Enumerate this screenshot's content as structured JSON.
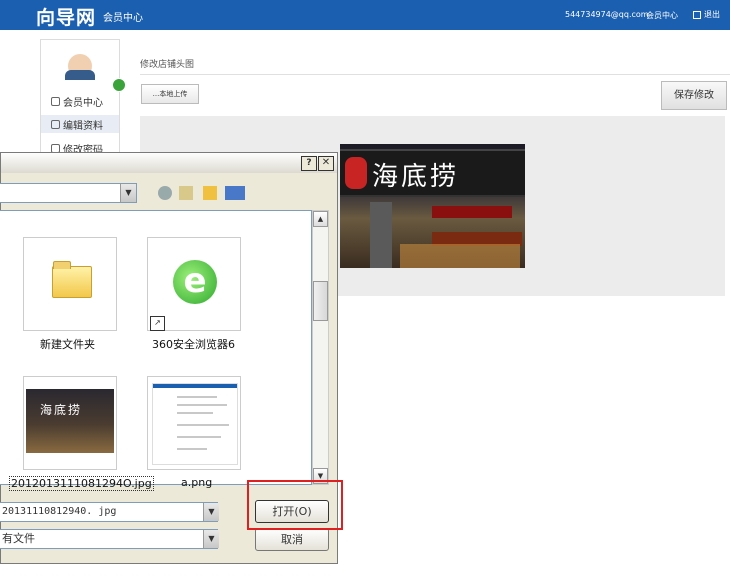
{
  "header": {
    "logo": "向导网",
    "logo_sub": "会员中心",
    "email": "544734974@qq.com",
    "member_link": "会员中心",
    "logout": "退出"
  },
  "sidebar": {
    "items": [
      {
        "label": "会员中心"
      },
      {
        "label": "编辑资料"
      },
      {
        "label": "修改密码"
      }
    ]
  },
  "main": {
    "section_title": "修改店铺头图",
    "upload_button": "...本地上传",
    "save_button": "保存修改",
    "preview_sign_text": "海底捞"
  },
  "dialog": {
    "files": [
      {
        "name": "新建文件夹",
        "type": "folder"
      },
      {
        "name": "360安全浏览器6",
        "type": "shortcut"
      },
      {
        "name": "2012013111081294O.jpg",
        "type": "image"
      },
      {
        "name": "a.png",
        "type": "image"
      }
    ],
    "thumb_text": "海底捞",
    "filename_value": "20131110812940. jpg",
    "filetype_value": "有文件",
    "open_button": "打开(O)",
    "cancel_button": "取消"
  },
  "colors": {
    "header_bg": "#1b5fb0",
    "highlight_border": "#e02020"
  }
}
